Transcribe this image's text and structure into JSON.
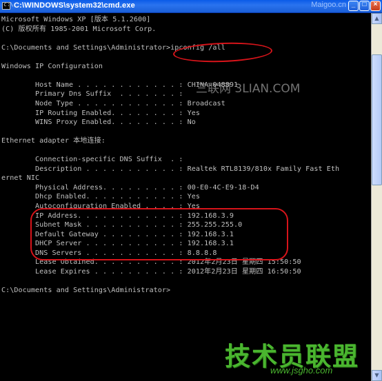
{
  "window": {
    "title": "C:\\WINDOWS\\system32\\cmd.exe",
    "icon": "cmd-icon",
    "controls": {
      "minimize": "_",
      "maximize": "□",
      "close": "×"
    }
  },
  "watermarks": {
    "top": "Maigoo.cn",
    "middle": "三联网 3LIAN.COM",
    "logo": "技术员联盟",
    "url": "www.jsgho.com"
  },
  "console": {
    "lines": [
      "Microsoft Windows XP [版本 5.1.2600]",
      "(C) 版权所有 1985-2001 Microsoft Corp.",
      "",
      "C:\\Documents and Settings\\Administrator>ipconfig /all",
      "",
      "Windows IP Configuration",
      "",
      "        Host Name . . . . . . . . . . . . : CHINA-048891",
      "        Primary Dns Suffix  . . . . . . . :",
      "        Node Type . . . . . . . . . . . . : Broadcast",
      "        IP Routing Enabled. . . . . . . . : Yes",
      "        WINS Proxy Enabled. . . . . . . . : No",
      "",
      "Ethernet adapter 本地连接:",
      "",
      "        Connection-specific DNS Suffix  . :",
      "        Description . . . . . . . . . . . : Realtek RTL8139/810x Family Fast Eth",
      "ernet NIC",
      "        Physical Address. . . . . . . . . : 00-E0-4C-E9-18-D4",
      "        Dhcp Enabled. . . . . . . . . . . : Yes",
      "        Autoconfiguration Enabled . . . . : Yes",
      "        IP Address. . . . . . . . . . . . : 192.168.3.9",
      "        Subnet Mask . . . . . . . . . . . : 255.255.255.0",
      "        Default Gateway . . . . . . . . . : 192.168.3.1",
      "        DHCP Server . . . . . . . . . . . : 192.168.3.1",
      "        DNS Servers . . . . . . . . . . . : 8.8.8.8",
      "        Lease Obtained. . . . . . . . . . : 2012年2月23日 星期四 15:50:50",
      "        Lease Expires . . . . . . . . . . : 2012年2月23日 星期四 16:50:50",
      "",
      "C:\\Documents and Settings\\Administrator>"
    ]
  },
  "colors": {
    "console_text": "#c0c0c0",
    "console_bg": "#000000",
    "annotation": "#d8141a",
    "titlebar": "#1f5fd8"
  }
}
